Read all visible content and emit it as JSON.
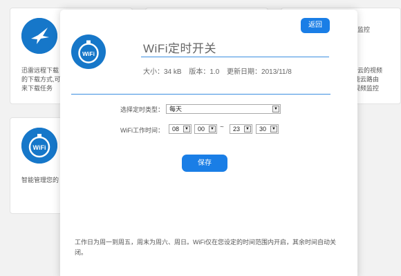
{
  "background_cards": {
    "xunlei": {
      "icon": "hummingbird-icon",
      "description": "迅雷远程下载\n的下载方式,可\n来下载任务"
    },
    "wifi": {
      "icon": "wifi-clock-icon",
      "description": "智能管理您的"
    },
    "right": {
      "title": "监控",
      "description": "d小云的视频\n智能云路由\n程视频监控"
    }
  },
  "modal": {
    "back_label": "返回",
    "app_icon": "wifi-clock-icon",
    "title": "WiFi定时开关",
    "meta": {
      "size": "大小：34 kB",
      "version": "版本：1.0",
      "updated": "更新日期：2013/11/8"
    },
    "form": {
      "type_label": "选择定时类型：",
      "type_value": "每天",
      "time_label": "WiFi工作时间：",
      "start_hour": "08",
      "start_minute": "00",
      "separator": "~",
      "end_hour": "23",
      "end_minute": "30"
    },
    "save_label": "保存",
    "footnote": "工作日为周一到周五，周末为周六、周日。WiFi仅在您设定的时间范围内开启，其余时间自动关闭。"
  },
  "colors": {
    "accent": "#1a7ee6",
    "icon_blue": "#1677c9",
    "divider": "#3a8ee0"
  }
}
